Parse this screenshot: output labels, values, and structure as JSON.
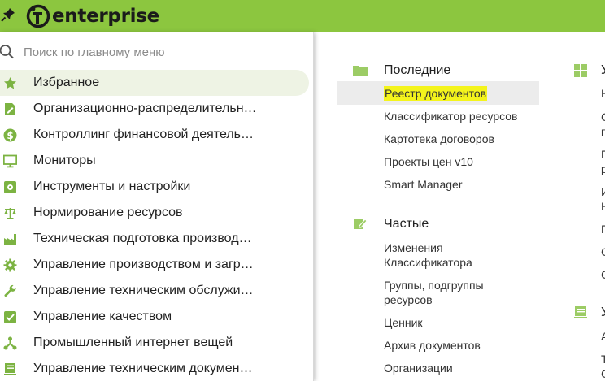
{
  "app": {
    "logo_text": "enterprise",
    "brand_color": "#8cc63f"
  },
  "search": {
    "placeholder": "Поиск по главному меню",
    "value": ""
  },
  "menu": {
    "items": [
      {
        "label": "Избранное",
        "icon": "star-icon",
        "active": true
      },
      {
        "label": "Организационно-распределительн…",
        "icon": "document-pencil-icon"
      },
      {
        "label": "Контроллинг финансовой деятель…",
        "icon": "dollar-circle-icon"
      },
      {
        "label": "Мониторы",
        "icon": "monitor-icon"
      },
      {
        "label": "Инструменты и настройки",
        "icon": "tools-gear-icon"
      },
      {
        "label": "Нормирование ресурсов",
        "icon": "scales-icon"
      },
      {
        "label": "Техническая подготовка производ…",
        "icon": "factory-icon"
      },
      {
        "label": "Управление производством и загр…",
        "icon": "gear-icon"
      },
      {
        "label": "Управление техническим обслужи…",
        "icon": "wrench-icon"
      },
      {
        "label": "Управление качеством",
        "icon": "checkbox-icon"
      },
      {
        "label": "Промышленный интернет вещей",
        "icon": "network-nodes-icon"
      },
      {
        "label": "Управление техническим докумен…",
        "icon": "document-stack-icon"
      }
    ]
  },
  "recent": {
    "title": "Последние",
    "icon": "folder-icon",
    "links": [
      "Реестр документов",
      "Классификатор ресурсов",
      "Картотека договоров",
      "Проекты цен v10",
      "Smart Manager"
    ],
    "highlighted_index": 0
  },
  "frequent": {
    "title": "Частые",
    "icon": "edit-note-icon",
    "links": [
      {
        "line1": "Изменения",
        "line2": "Классификатора"
      },
      {
        "line1": "Группы, подгруппы",
        "line2": "ресурсов"
      },
      {
        "line1": "Ценник",
        "line2": ""
      },
      {
        "line1": "Архив документов",
        "line2": ""
      },
      {
        "line1": "Организации",
        "line2": ""
      }
    ]
  },
  "third_column": {
    "sections": [
      {
        "title": "У",
        "icon": "grid-tiles-icon"
      },
      {
        "title": "У",
        "icon": "document-stack-icon"
      }
    ],
    "fragments": [
      "Н",
      "С",
      "п",
      "П",
      "р",
      "И",
      "Н",
      "П",
      "С",
      "С",
      "А",
      "Т",
      "С"
    ]
  }
}
